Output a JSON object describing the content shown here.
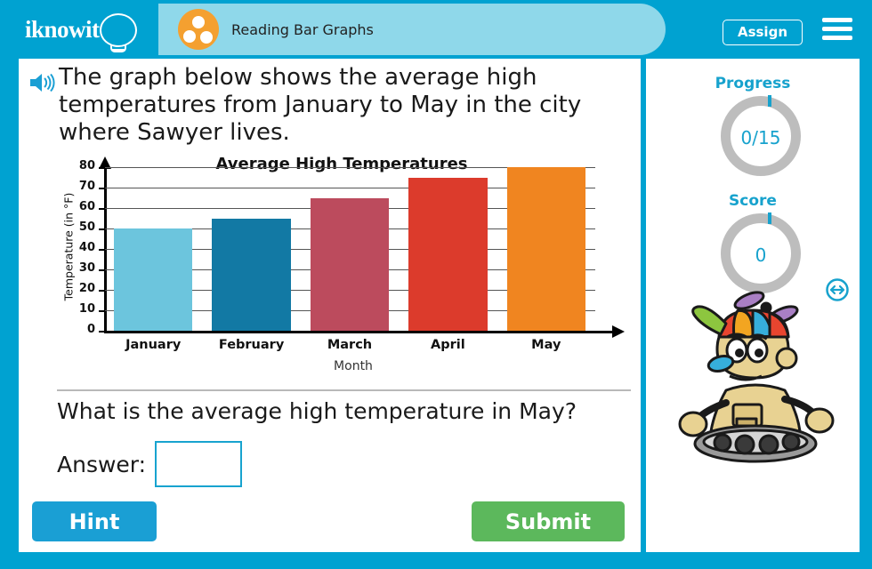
{
  "header": {
    "logo_text": "iknowit",
    "logo_icon": "lightbulb-icon",
    "subject_icon": "three-dots-circle-icon",
    "lesson_title": "Reading Bar Graphs",
    "assign_label": "Assign",
    "menu_icon": "hamburger-menu-icon",
    "bg_color": "#00a2d1",
    "pill_color": "#8fd8ea",
    "subject_icon_color": "#f4a030"
  },
  "prompt": {
    "speaker_icon": "speaker-audio-icon",
    "text": "The graph below shows the average high temperatures from January to May in the city where Sawyer lives."
  },
  "chart_data": {
    "type": "bar",
    "title": "Average High Temperatures",
    "xlabel": "Month",
    "ylabel": "Temperature (in °F)",
    "categories": [
      "January",
      "February",
      "March",
      "April",
      "May"
    ],
    "values": [
      50,
      55,
      65,
      75,
      80
    ],
    "colors": [
      "#6cc5dd",
      "#1279a4",
      "#bc4b5d",
      "#dc3b2c",
      "#f08520"
    ],
    "ylim": [
      0,
      80
    ],
    "yticks": [
      0,
      10,
      20,
      30,
      40,
      50,
      60,
      70,
      80
    ],
    "grid": true,
    "legend": "none"
  },
  "question": {
    "text": "What is the average high temperature in May?",
    "answer_label": "Answer:",
    "answer_value": "",
    "answer_placeholder": ""
  },
  "actions": {
    "hint_label": "Hint",
    "submit_label": "Submit",
    "hint_color": "#1a9fd4",
    "submit_color": "#5cb85c"
  },
  "sidebar": {
    "progress_label": "Progress",
    "progress_value": "0/15",
    "score_label": "Score",
    "score_value": "0",
    "ring_color": "#bdbdbd",
    "accent_color": "#17a2cd",
    "mascot_icon": "robot-mascot-icon",
    "resize_icon": "resize-horizontal-icon"
  }
}
